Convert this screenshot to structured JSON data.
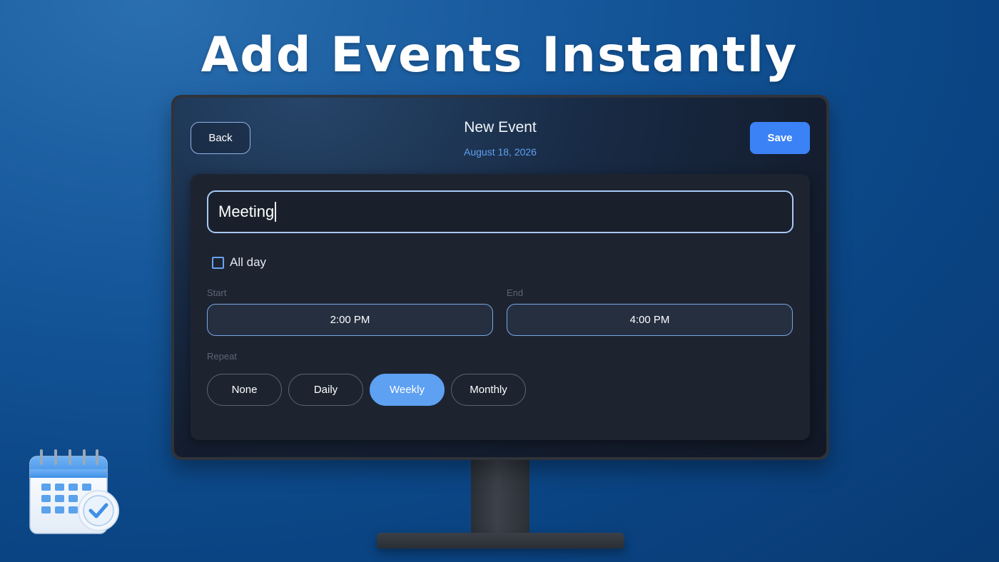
{
  "headline": "Add Events Instantly",
  "header": {
    "back_label": "Back",
    "title": "New Event",
    "date": "August 18, 2026",
    "save_label": "Save"
  },
  "form": {
    "title_value": "Meeting",
    "all_day_label": "All day",
    "all_day_checked": false,
    "start_label": "Start",
    "start_value": "2:00 PM",
    "end_label": "End",
    "end_value": "4:00 PM",
    "repeat_label": "Repeat",
    "repeat_options": [
      "None",
      "Daily",
      "Weekly",
      "Monthly"
    ],
    "repeat_selected": "Weekly"
  },
  "decor": {
    "corner_icon": "calendar-check-icon"
  },
  "colors": {
    "accent": "#3b82f6",
    "selected_pill": "#5ea0f2",
    "date_text": "#5ea0f2",
    "background": "#0b4686"
  }
}
